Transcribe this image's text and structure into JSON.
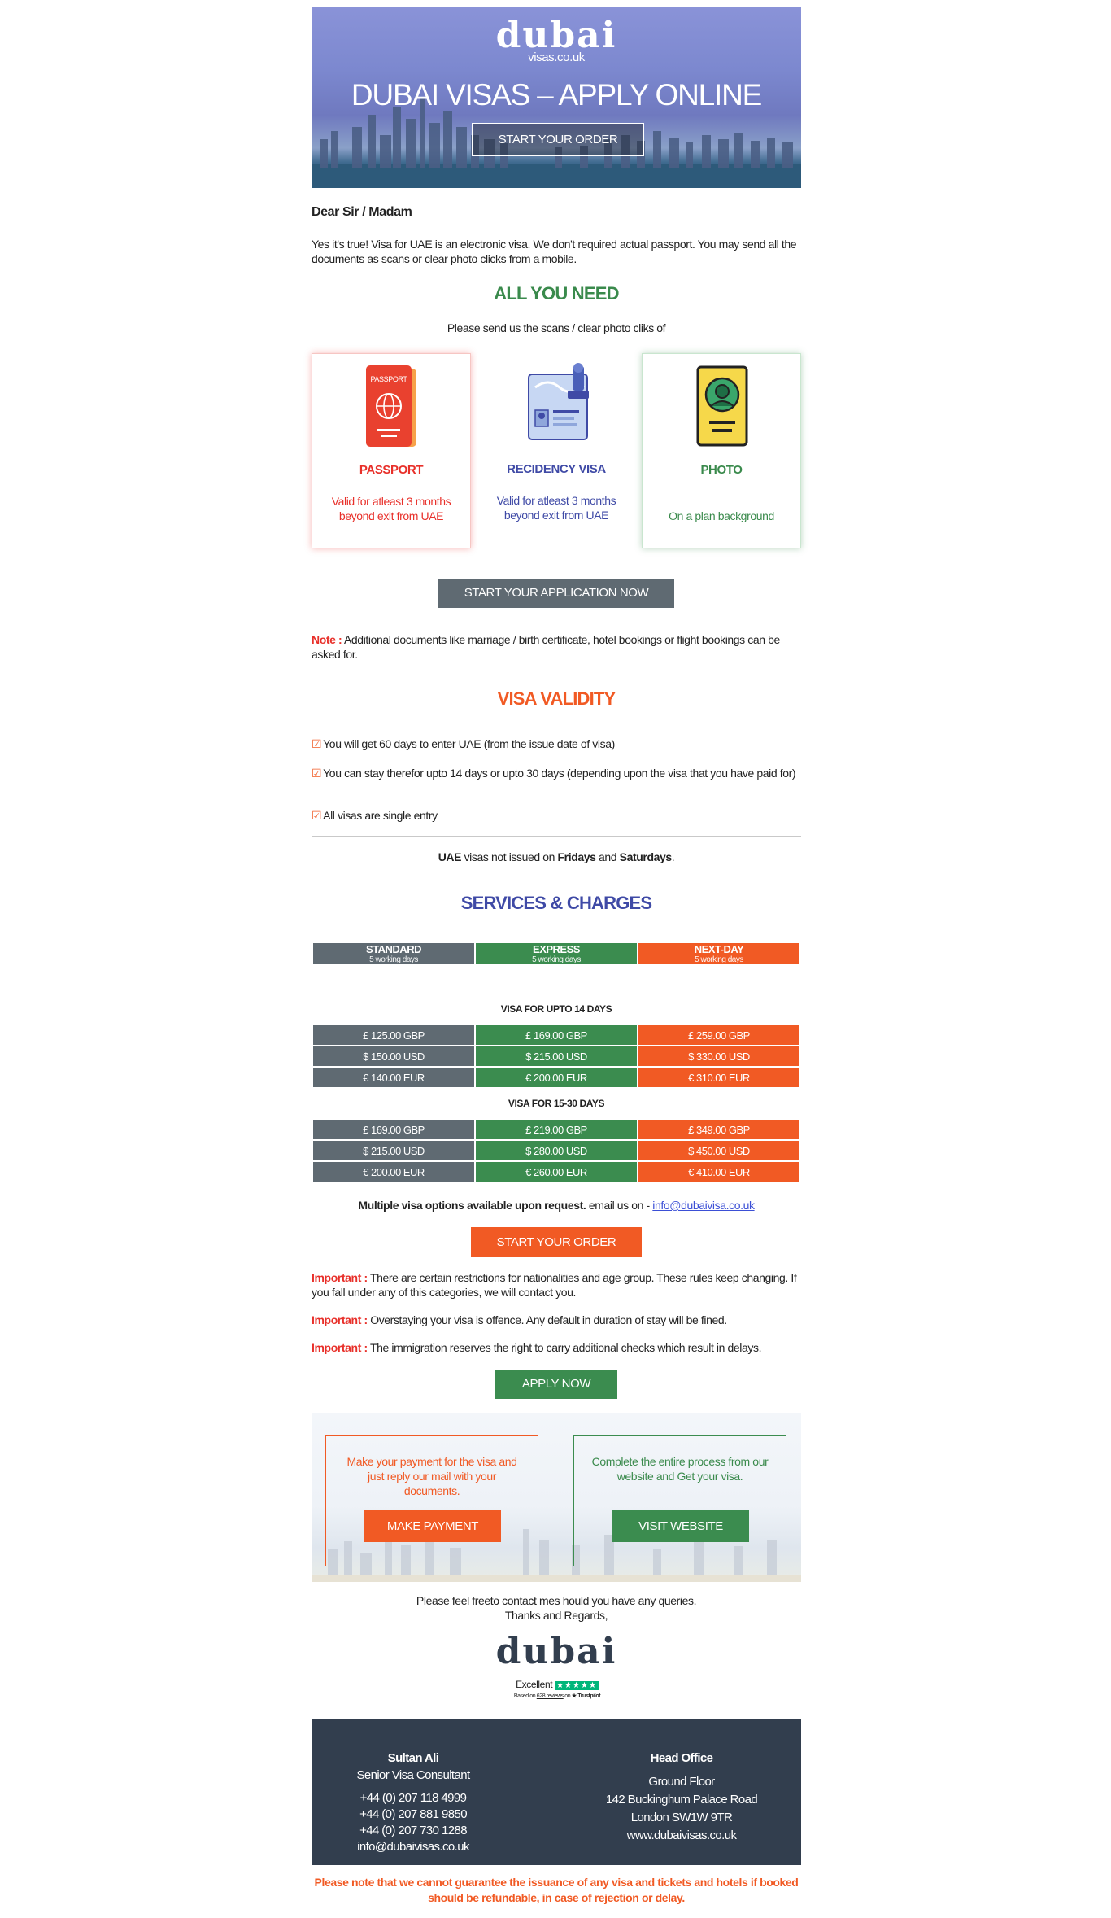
{
  "hero": {
    "logo_main": "dubai",
    "logo_sub": "visas.co.uk",
    "title": "DUBAI VISAS – APPLY ONLINE",
    "cta": "START YOUR ORDER"
  },
  "greeting": "Dear Sir / Madam",
  "intro": "Yes it's true! Visa for UAE is an electronic visa. We don't required actual passport. You may send all the documents as scans or clear photo clicks from a mobile.",
  "need": {
    "heading": "ALL YOU NEED",
    "subtitle": "Please send us the scans / clear photo cliks of",
    "cards": [
      {
        "title": "PASSPORT",
        "desc": "Valid for atleast 3 months beyond exit from UAE",
        "icon": "passport-icon",
        "color": "#e8302a"
      },
      {
        "title": "RECIDENCY VISA",
        "desc": "Valid for atleast 3 months beyond exit from UAE",
        "icon": "residency-visa-icon",
        "color": "#3f4aa6"
      },
      {
        "title": "PHOTO",
        "desc": "On a plan background",
        "icon": "photo-id-icon",
        "color": "#3a8a4c"
      }
    ],
    "passport_word": "PASSPORT",
    "cta": "START YOUR APPLICATION NOW"
  },
  "note": {
    "label": "Note :",
    "text": " Additional documents like marriage / birth certificate, hotel bookings or flight bookings can be asked for."
  },
  "validity": {
    "heading": "VISA VALIDITY",
    "check_glyph": "☑",
    "items": [
      "You will get 60 days to enter UAE (from the issue date of visa)",
      "You can stay therefor upto 14 days or upto 30 days (depending upon the visa that you have paid for)",
      "All visas are single entry"
    ],
    "notice": {
      "a": "UAE",
      "b": " visas not issued on ",
      "c": "Fridays",
      "d": " and ",
      "e": "Saturdays",
      "f": "."
    }
  },
  "services": {
    "heading": "SERVICES & CHARGES",
    "columns": [
      {
        "name": "STANDARD",
        "sub": "5 working days"
      },
      {
        "name": "EXPRESS",
        "sub": "5 working days"
      },
      {
        "name": "NEXT-DAY",
        "sub": "5 working days"
      }
    ],
    "group1_title": "VISA FOR UPTO 14 DAYS",
    "group1": [
      [
        "£ 125.00 GBP",
        "£ 169.00 GBP",
        "£ 259.00 GBP"
      ],
      [
        "$ 150.00 USD",
        "$ 215.00 USD",
        "$ 330.00 USD"
      ],
      [
        "€ 140.00 EUR",
        "€ 200.00 EUR",
        "€ 310.00 EUR"
      ]
    ],
    "group2_title": "VISA FOR 15-30 DAYS",
    "group2": [
      [
        "£ 169.00 GBP",
        "£ 219.00 GBP",
        "£ 349.00 GBP"
      ],
      [
        "$ 215.00 USD",
        "$ 280.00 USD",
        "$ 450.00 USD"
      ],
      [
        "€ 200.00 EUR",
        "€ 260.00 EUR",
        "€ 410.00 EUR"
      ]
    ],
    "multi_bold": "Multiple visa options available upon request.",
    "multi_text": " email us on - ",
    "email": "info@dubaivisa.co.uk",
    "cta": "START YOUR ORDER"
  },
  "important": {
    "label": "Important :",
    "items": [
      " There are certain restrictions for nationalities and age group. These rules keep changing. If you fall under any of this categories, we will contact you.",
      " Overstaying your visa is offence. Any default in duration of stay will be fined.",
      " The immigration reserves the right to carry additional checks which result in delays."
    ],
    "cta": "APPLY NOW"
  },
  "payment": {
    "left_text": "Make your payment for the visa and just reply our mail with your documents.",
    "left_button": "MAKE PAYMENT",
    "right_text": "Complete the entire process from our website and Get your visa.",
    "right_button": "VISIT WEBSITE"
  },
  "closing": {
    "line1": "Please feel freeto contact mes hould you have any queries.",
    "line2": "Thanks and Regards,",
    "logo": "dubai",
    "rating_word": "Excellent",
    "stars": "★★★★★",
    "based_on": "Based on",
    "reviews": "628 reviews",
    "on": "on",
    "trustpilot": "★ Trustpilot"
  },
  "footer": {
    "name": "Sultan Ali",
    "role": "Senior Visa Consultant",
    "phones": [
      "+44 (0) 207 118 4999",
      "+44 (0) 207 881 9850",
      "+44 (0) 207 730 1288"
    ],
    "email": "info@dubaivisas.co.uk",
    "office_title": "Head Office",
    "address": [
      "Ground Floor",
      "142 Buckinghum Palace Road",
      "London SW1W 9TR",
      "www.dubaivisas.co.uk"
    ]
  },
  "disclaimer": "Please note that we cannot guarantee the issuance of any visa and tickets and hotels if booked should be refundable, in case of rejection or delay.",
  "colors": {
    "green": "#3a8a4c",
    "orange": "#f15a24",
    "blue": "#3f4aa6",
    "red": "#e8302a",
    "grey": "#5f6a72",
    "footer": "#323e4e"
  }
}
